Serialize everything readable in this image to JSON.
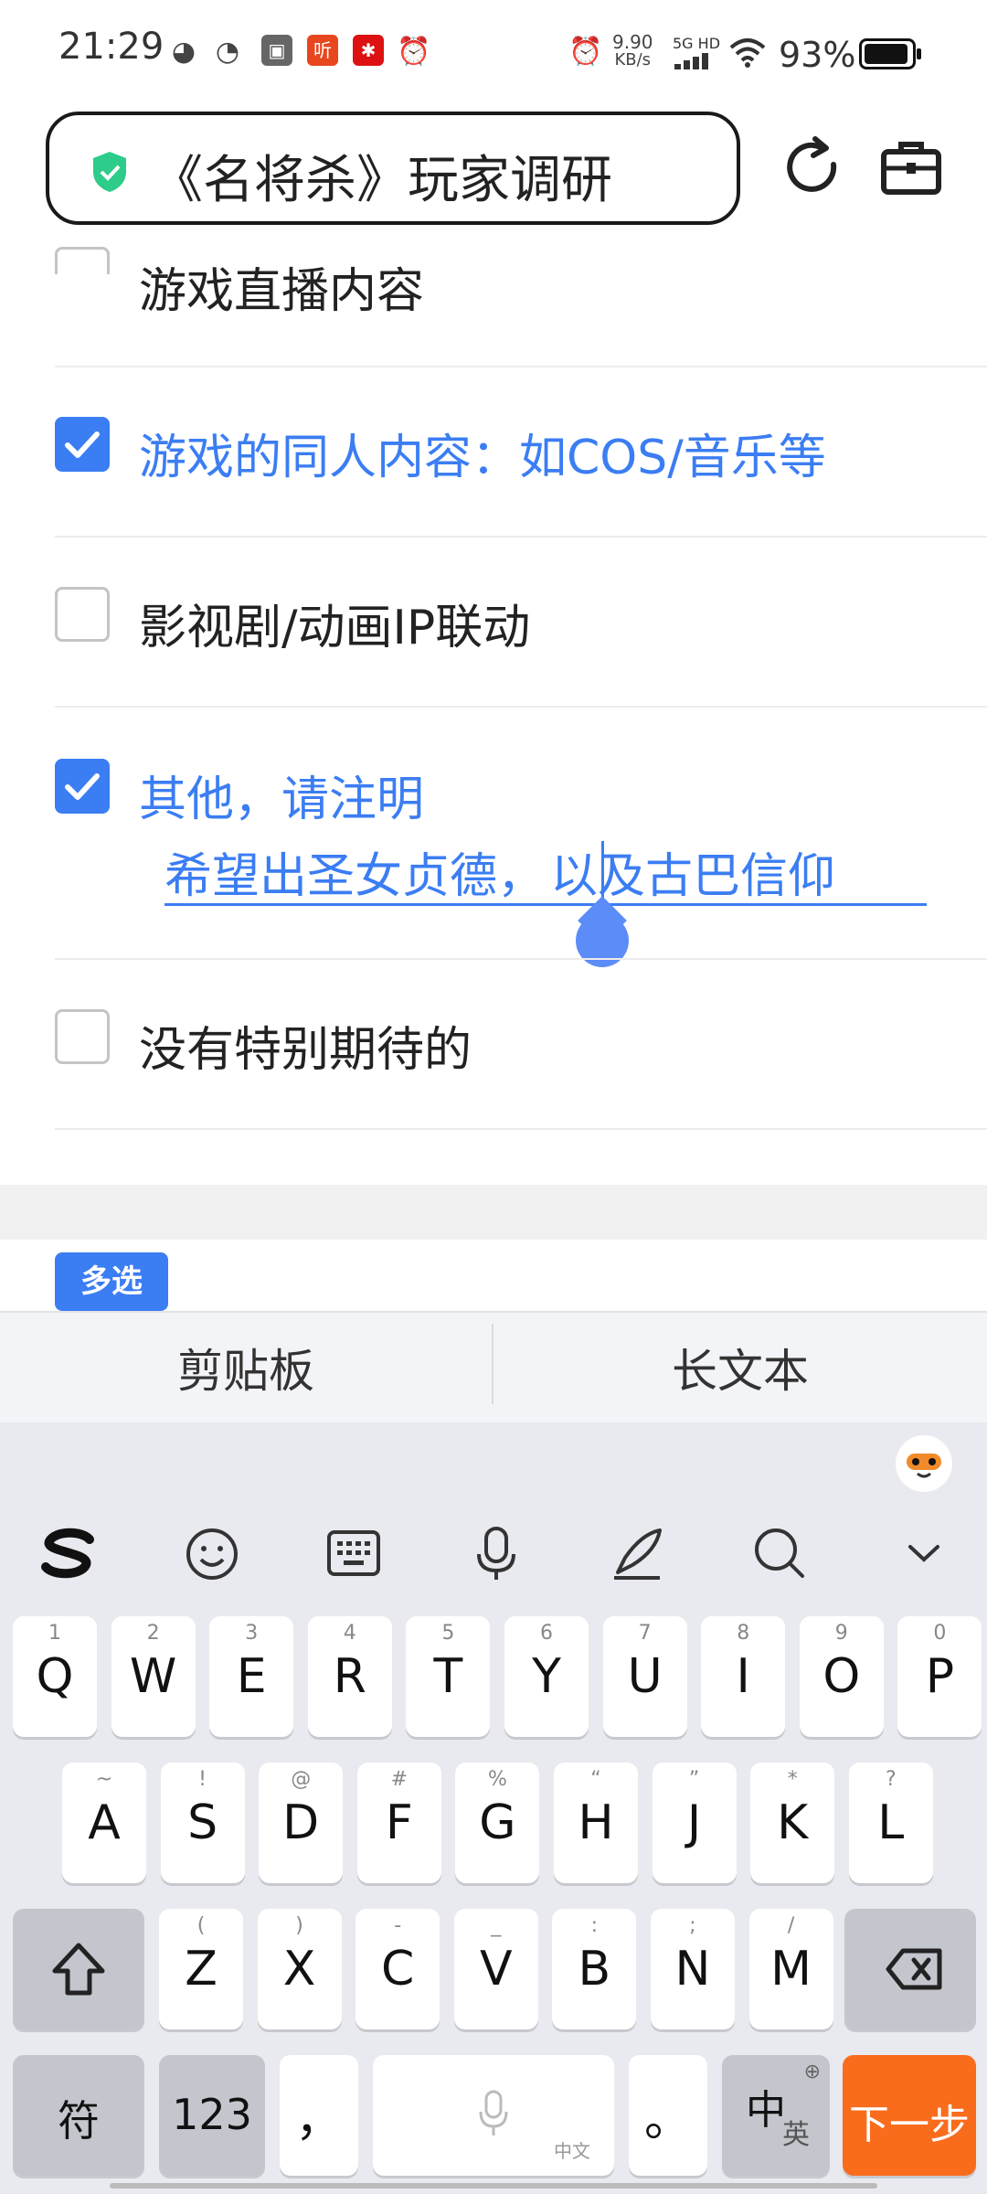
{
  "status_bar": {
    "time": "21:29",
    "net_speed": "9.90",
    "net_unit": "KB/s",
    "signal": "5G HD",
    "battery": "93%",
    "battery_level": 0.93,
    "listen_icon_text": "听"
  },
  "header": {
    "title": "《名将杀》玩家调研",
    "shield_color": "#2ecc8a"
  },
  "options": [
    {
      "label": "游戏直播内容",
      "checked": false
    },
    {
      "label": "游戏的同人内容：如COS/音乐等",
      "checked": true
    },
    {
      "label": "影视剧/动画IP联动",
      "checked": false
    },
    {
      "label": "其他，请注明",
      "checked": true
    },
    {
      "label": "没有特别期待的",
      "checked": false
    }
  ],
  "other_input": {
    "value_before_caret": "希望出圣女贞德，",
    "value_after_caret": "以及古巴信仰"
  },
  "question_type_badge": "多选",
  "keyboard": {
    "clipboard": "剪贴板",
    "long_text": "长文本",
    "row1": [
      {
        "main": "Q",
        "sub": "1"
      },
      {
        "main": "W",
        "sub": "2"
      },
      {
        "main": "E",
        "sub": "3"
      },
      {
        "main": "R",
        "sub": "4"
      },
      {
        "main": "T",
        "sub": "5"
      },
      {
        "main": "Y",
        "sub": "6"
      },
      {
        "main": "U",
        "sub": "7"
      },
      {
        "main": "I",
        "sub": "8"
      },
      {
        "main": "O",
        "sub": "9"
      },
      {
        "main": "P",
        "sub": "0"
      }
    ],
    "row2": [
      {
        "main": "A",
        "sub": "~"
      },
      {
        "main": "S",
        "sub": "!"
      },
      {
        "main": "D",
        "sub": "@"
      },
      {
        "main": "F",
        "sub": "#"
      },
      {
        "main": "G",
        "sub": "%"
      },
      {
        "main": "H",
        "sub": "“"
      },
      {
        "main": "J",
        "sub": "”"
      },
      {
        "main": "K",
        "sub": "*"
      },
      {
        "main": "L",
        "sub": "?"
      }
    ],
    "row3": [
      {
        "main": "Z",
        "sub": "("
      },
      {
        "main": "X",
        "sub": ")"
      },
      {
        "main": "C",
        "sub": "-"
      },
      {
        "main": "V",
        "sub": "_"
      },
      {
        "main": "B",
        "sub": ":"
      },
      {
        "main": "N",
        "sub": ";"
      },
      {
        "main": "M",
        "sub": "/"
      }
    ],
    "symbols": "符",
    "numbers": "123",
    "comma": "，",
    "period": "。",
    "space_hint": "中文",
    "lang_main": "中",
    "lang_sub": "英",
    "next": "下一步",
    "accent": "#f96c1c"
  }
}
